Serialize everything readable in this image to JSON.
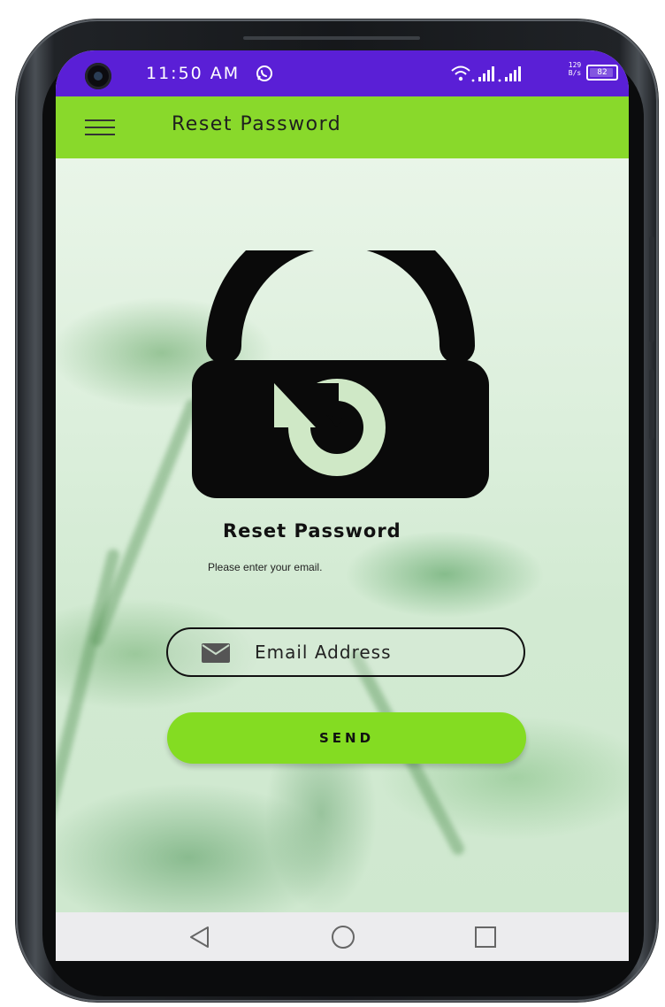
{
  "status_bar": {
    "time": "11:50 AM",
    "network_speed_value": "129",
    "network_speed_unit": "B/s",
    "battery_level": "82",
    "background_color": "#5a1fd6",
    "icons": [
      "camera-icon",
      "whatsapp-icon",
      "wifi-icon",
      "signal-icon",
      "battery-icon"
    ]
  },
  "app_bar": {
    "title": "Reset Password",
    "menu_icon": "hamburger-menu-icon",
    "background_color": "#89d92b"
  },
  "main": {
    "hero_icon": "lock-reset-icon",
    "heading": "Reset Password",
    "subtext": "Please enter your email.",
    "email_field": {
      "icon": "mail-icon",
      "value": "",
      "placeholder": "Email Address"
    },
    "send_button_label": "SEND",
    "accent_color": "#84dc22"
  },
  "nav_bar": {
    "buttons": [
      "back-icon",
      "home-icon",
      "recents-icon"
    ]
  }
}
